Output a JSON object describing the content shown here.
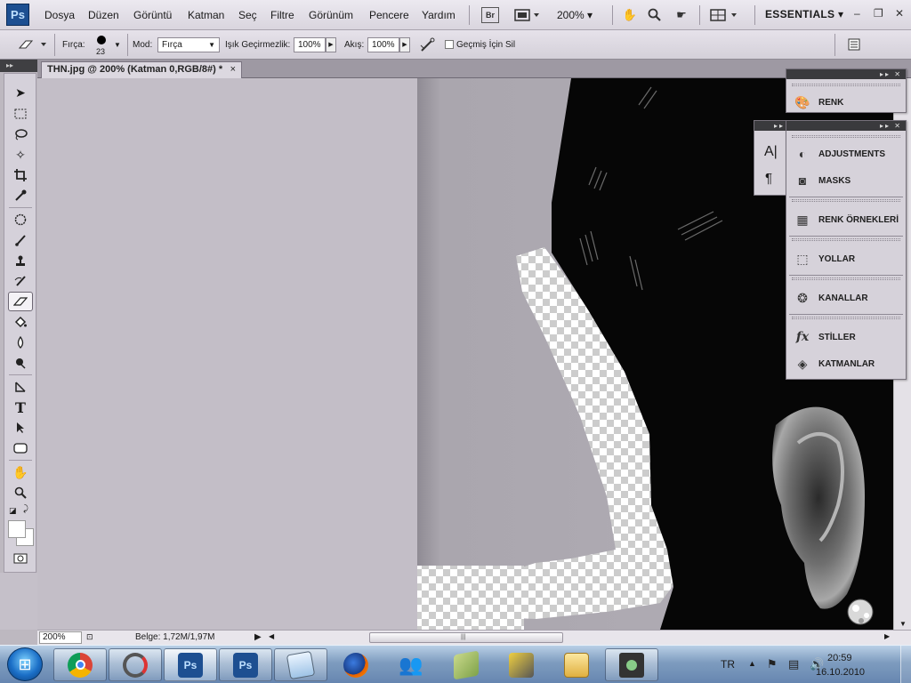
{
  "app": {
    "logo": "Ps"
  },
  "menu": {
    "items": [
      "Dosya",
      "Düzen",
      "Görüntü",
      "Katman",
      "Seç",
      "Filtre",
      "Görünüm",
      "Pencere",
      "Yardım"
    ],
    "bridge": "Br",
    "zoom": "200%",
    "workspace": "ESSENTIALS"
  },
  "options": {
    "brush_label": "Fırça:",
    "brush_size": "23",
    "mode_label": "Mod:",
    "mode_value": "Fırça",
    "opacity_label": "Işık Geçirmezlik:",
    "opacity_value": "100%",
    "flow_label": "Akış:",
    "flow_value": "100%",
    "history_label": "Geçmiş İçin Sil"
  },
  "document": {
    "tab_title": "THN.jpg @ 200% (Katman 0,RGB/8#) *",
    "close": "×"
  },
  "status": {
    "zoom": "200%",
    "doc_info": "Belge: 1,72M/1,97M"
  },
  "panels": {
    "top": {
      "items": [
        "RENK"
      ]
    },
    "middle": {
      "items": [
        "ADJUSTMENTS",
        "MASKS",
        "RENK ÖRNEKLERİ",
        "YOLLAR",
        "KANALLAR",
        "STİLLER",
        "KATMANLAR"
      ]
    }
  },
  "taskbar": {
    "apps": [
      "chrome",
      "app2",
      "photoshop",
      "photoshop",
      "notes",
      "firefox",
      "messenger",
      "maps",
      "media",
      "explorer",
      "media-player"
    ],
    "language": "TR",
    "time": "20:59",
    "date": "16.10.2010"
  }
}
